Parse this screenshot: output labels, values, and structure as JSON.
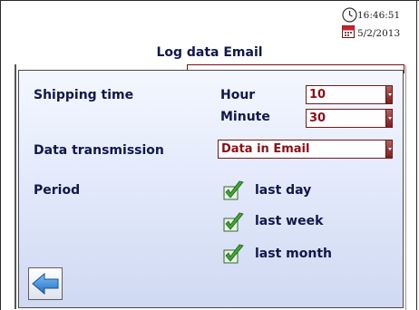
{
  "status": {
    "time": "16:46:51",
    "date": "5/2/2013",
    "clock_icon": "clock-icon",
    "calendar_icon": "calendar-icon"
  },
  "page": {
    "title": "Log data Email"
  },
  "form": {
    "shipping_time_label": "Shipping time",
    "hour_label": "Hour",
    "hour_value": "10",
    "minute_label": "Minute",
    "minute_value": "30",
    "data_transmission_label": "Data transmission",
    "data_transmission_value": "Data in Email",
    "period_label": "Period",
    "period_options": [
      {
        "label": "last day",
        "checked": true
      },
      {
        "label": "last week",
        "checked": true
      },
      {
        "label": "last month",
        "checked": true
      }
    ]
  },
  "colors": {
    "label_text": "#10184a",
    "value_text": "#8b0f16",
    "field_border": "#6d1a1a",
    "check_green": "#3fa535"
  },
  "back_button_icon": "arrow-left-icon"
}
